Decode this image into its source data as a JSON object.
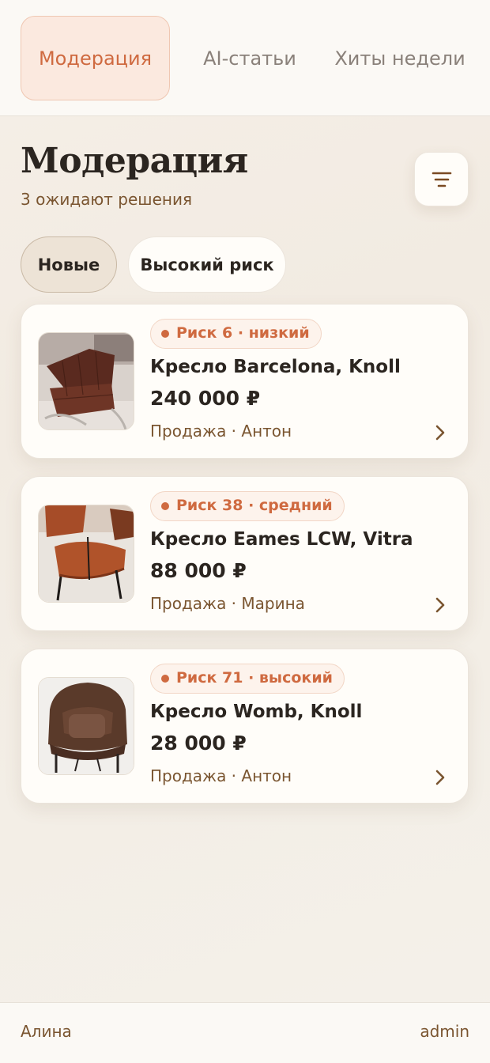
{
  "tabs": [
    {
      "label": "Модерация",
      "active": true
    },
    {
      "label": "AI-статьи",
      "active": false
    },
    {
      "label": "Хиты недели",
      "active": false
    }
  ],
  "header": {
    "title": "Модерация",
    "subtitle": "3 ожидают решения",
    "filter_icon": "sliders-icon"
  },
  "filters": [
    {
      "label": "Новые",
      "selected": true
    },
    {
      "label": "Высокий риск",
      "selected": false
    }
  ],
  "items": [
    {
      "risk": "Риск 6 · низкий",
      "title": "Кресло Barcelona, Knoll",
      "price": "240 000 ₽",
      "meta": "Продажа · Антон",
      "image": "barcelona-chair-photo"
    },
    {
      "risk": "Риск 38 · средний",
      "title": "Кресло Eames LCW, Vitra",
      "price": "88 000 ₽",
      "meta": "Продажа · Марина",
      "image": "eames-lcw-chair-photo"
    },
    {
      "risk": "Риск 71 · высокий",
      "title": "Кресло Womb, Knoll",
      "price": "28 000 ₽",
      "meta": "Продажа · Антон",
      "image": "womb-chair-photo"
    }
  ],
  "footer": {
    "user": "Алина",
    "role": "admin"
  },
  "colors": {
    "accent": "#cf6a40",
    "brown_text": "#7a5530",
    "background": "#f4efe7"
  }
}
